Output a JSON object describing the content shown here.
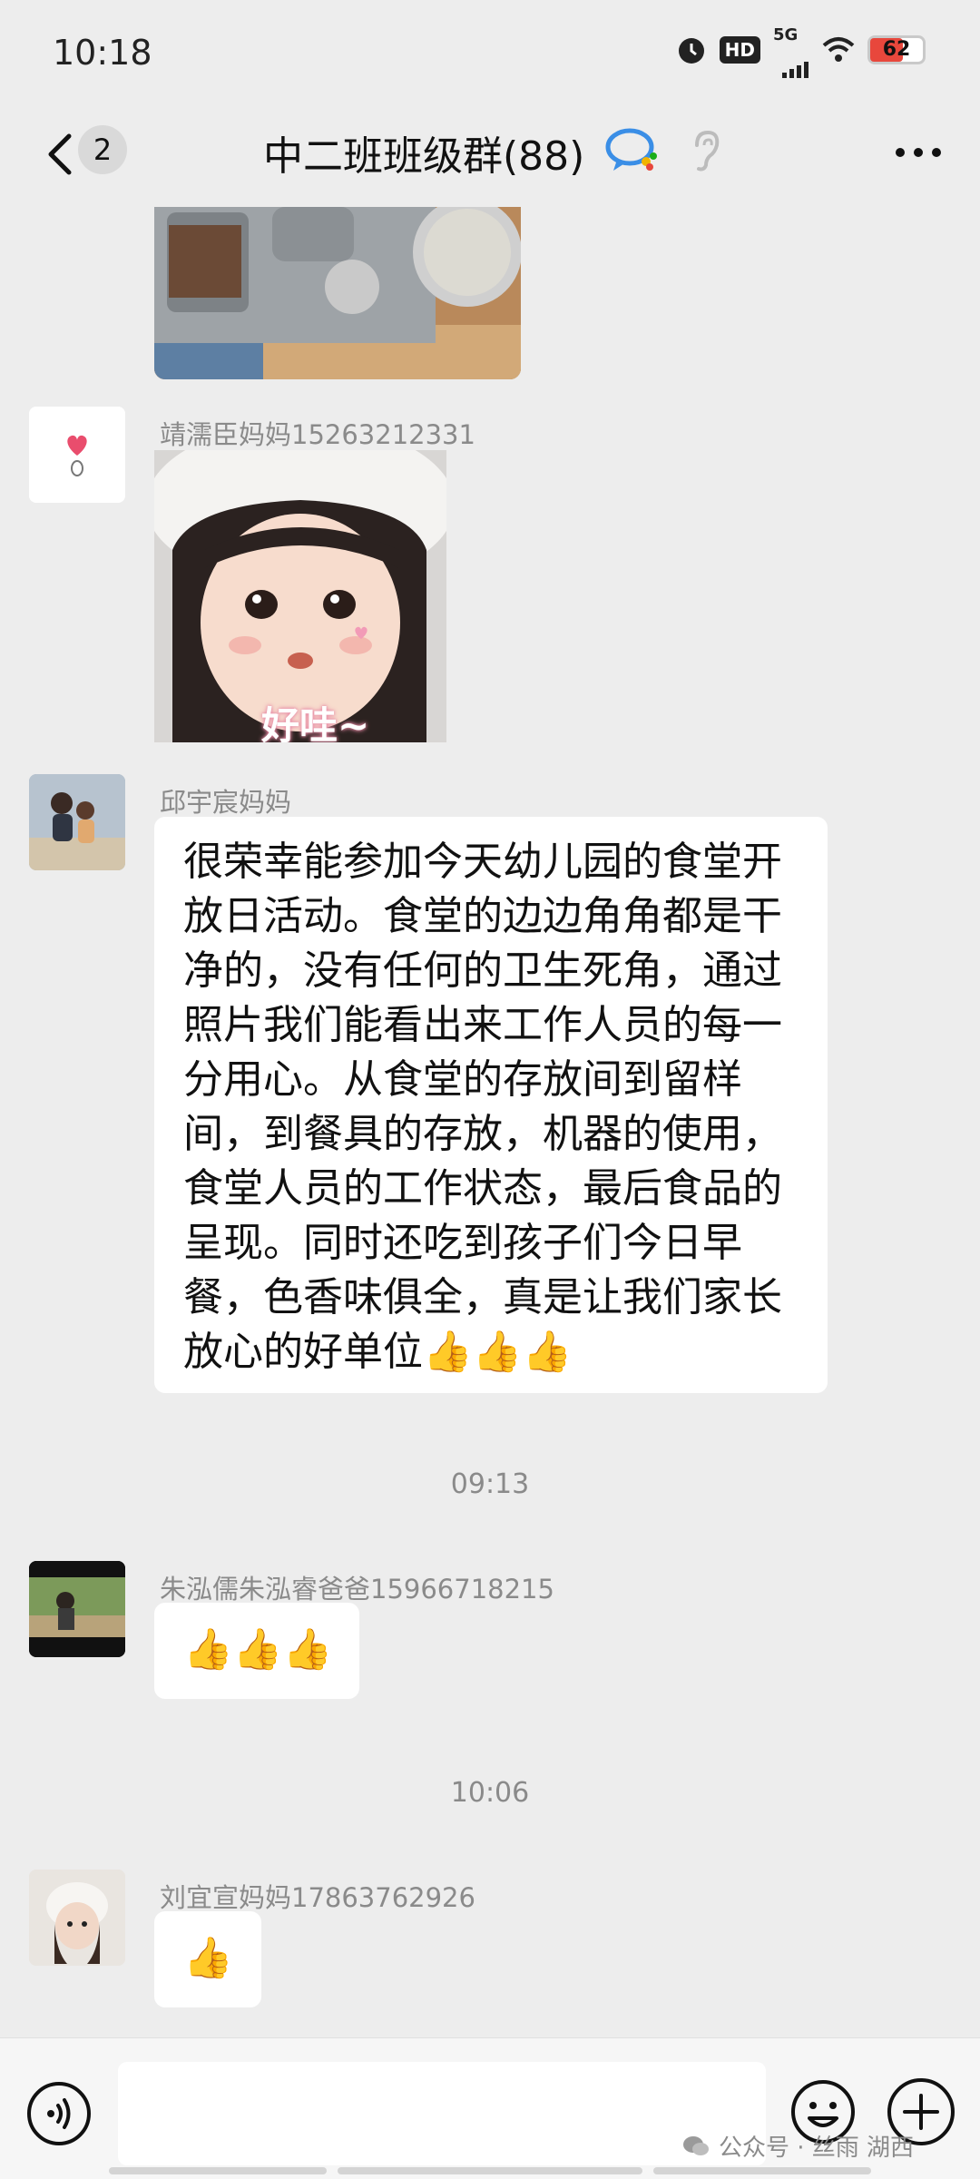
{
  "status_bar": {
    "time": "10:18",
    "hd": "HD",
    "network": "5G",
    "battery": "62",
    "battery_level": 0.62
  },
  "header": {
    "unread_count": "2",
    "title": "中二班班级群(88)"
  },
  "messages": [
    {
      "sender": "靖濡臣妈妈15263212331",
      "image_caption": "好哇~"
    },
    {
      "sender": "邱宇宸妈妈",
      "text": "很荣幸能参加今天幼儿园的食堂开放日活动。食堂的边边角角都是干净的，没有任何的卫生死角，通过照片我们能看出来工作人员的每一分用心。从食堂的存放间到留样间，到餐具的存放，机器的使用，食堂人员的工作状态，最后食品的呈现。同时还吃到孩子们今日早餐，色香味俱全，真是让我们家长放心的好单位👍👍👍"
    },
    {
      "timestamp": "09:13"
    },
    {
      "sender": "朱泓儒朱泓睿爸爸15966718215",
      "text": "👍👍👍"
    },
    {
      "timestamp": "10:06"
    },
    {
      "sender": "刘宜宣妈妈17863762926",
      "text": "👍"
    }
  ],
  "watermark": "公众号 · 丝雨 湖西",
  "colors": {
    "background": "#ededed",
    "bubble": "#ffffff",
    "sender": "#8a8a8a",
    "accent": "#1aad19"
  }
}
